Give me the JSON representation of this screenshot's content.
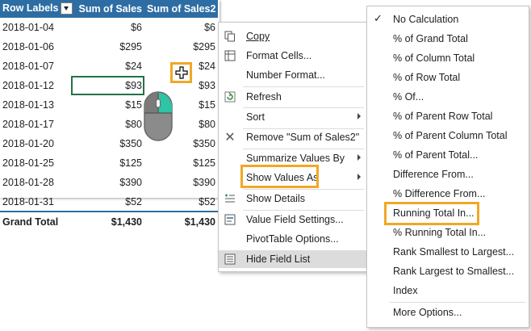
{
  "pivot": {
    "headers": [
      "Row Labels",
      "Sum of Sales",
      "Sum of Sales2"
    ],
    "rows": [
      {
        "label": "2018-01-04",
        "sales": "$6",
        "sales2": "$6"
      },
      {
        "label": "2018-01-06",
        "sales": "$295",
        "sales2": "$295"
      },
      {
        "label": "2018-01-07",
        "sales": "$24",
        "sales2": "$24"
      },
      {
        "label": "2018-01-12",
        "sales": "$93",
        "sales2": "$93"
      },
      {
        "label": "2018-01-13",
        "sales": "$15",
        "sales2": "$15"
      },
      {
        "label": "2018-01-17",
        "sales": "$80",
        "sales2": "$80"
      },
      {
        "label": "2018-01-20",
        "sales": "$350",
        "sales2": "$350"
      },
      {
        "label": "2018-01-25",
        "sales": "$125",
        "sales2": "$125"
      },
      {
        "label": "2018-01-28",
        "sales": "$390",
        "sales2": "$390"
      },
      {
        "label": "2018-01-31",
        "sales": "$52",
        "sales2": "$52"
      }
    ],
    "total": {
      "label": "Grand Total",
      "sales": "$1,430",
      "sales2": "$1,430"
    }
  },
  "context_menu": {
    "copy": "Copy",
    "format_cells": "Format Cells...",
    "number_format": "Number Format...",
    "refresh": "Refresh",
    "sort": "Sort",
    "remove": "Remove \"Sum of Sales2\"",
    "summarize": "Summarize Values By",
    "show_values_as": "Show Values As",
    "show_details": "Show Details",
    "value_field_settings": "Value Field Settings...",
    "pivot_options": "PivotTable Options...",
    "hide_field_list": "Hide Field List"
  },
  "submenu": {
    "items": [
      "No Calculation",
      "% of Grand Total",
      "% of Column Total",
      "% of Row Total",
      "% Of...",
      "% of Parent Row Total",
      "% of Parent Column Total",
      "% of Parent Total...",
      "Difference From...",
      "% Difference From...",
      "Running Total In...",
      "% Running Total In...",
      "Rank Smallest to Largest...",
      "Rank Largest to Smallest...",
      "Index",
      "More Options..."
    ],
    "checked": "No Calculation"
  },
  "colors": {
    "header": "#2e6da4",
    "highlight": "#f0a826",
    "selection": "#217346"
  }
}
